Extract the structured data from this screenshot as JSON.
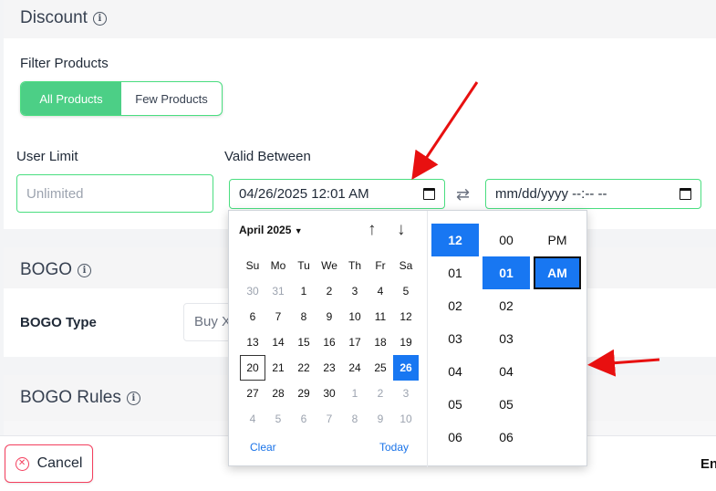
{
  "discount": {
    "title": "Discount",
    "filter_label": "Filter Products",
    "filter_options": [
      "All Products",
      "Few Products"
    ],
    "user_limit_label": "User Limit",
    "user_limit_placeholder": "Unlimited",
    "valid_between_label": "Valid Between",
    "start_value": "04/26/2025 12:01 AM",
    "end_placeholder": "mm/dd/yyyy --:-- --"
  },
  "bogo": {
    "title": "BOGO",
    "type_label": "BOGO Type",
    "type_value": "Buy X"
  },
  "bogo_rules": {
    "title": "BOGO Rules"
  },
  "picker": {
    "month": "April 2025",
    "weekdays": [
      "Su",
      "Mo",
      "Tu",
      "We",
      "Th",
      "Fr",
      "Sa"
    ],
    "weeks": [
      [
        "30",
        "31",
        "1",
        "2",
        "3",
        "4",
        "5"
      ],
      [
        "6",
        "7",
        "8",
        "9",
        "10",
        "11",
        "12"
      ],
      [
        "13",
        "14",
        "15",
        "16",
        "17",
        "18",
        "19"
      ],
      [
        "20",
        "21",
        "22",
        "23",
        "24",
        "25",
        "26"
      ],
      [
        "27",
        "28",
        "29",
        "30",
        "1",
        "2",
        "3"
      ],
      [
        "4",
        "5",
        "6",
        "7",
        "8",
        "9",
        "10"
      ]
    ],
    "clear": "Clear",
    "today": "Today",
    "hours": [
      "12",
      "01",
      "02",
      "03",
      "04",
      "05",
      "06"
    ],
    "minutes": [
      "00",
      "01",
      "02",
      "03",
      "04",
      "05",
      "06"
    ],
    "periods": [
      "PM",
      "AM"
    ],
    "selected_date": "26",
    "today_date": "20",
    "selected_hour": "12",
    "selected_minute": "01",
    "selected_period": "AM"
  },
  "footer": {
    "cancel": "Cancel",
    "right_text": "En"
  },
  "colors": {
    "accent_green": "#4ccf86",
    "select_blue": "#1877f2",
    "danger": "#f43f5e",
    "annotation_red": "#e81010"
  }
}
